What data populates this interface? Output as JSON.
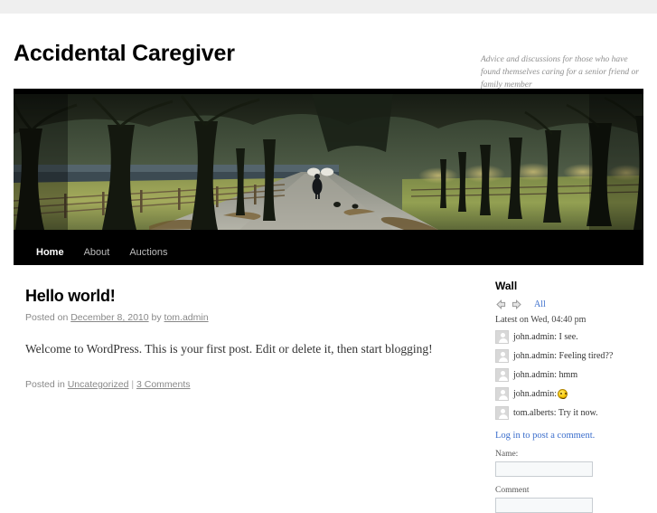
{
  "site": {
    "title": "Accidental Caregiver",
    "description": "Advice and discussions for those who have found themselves caring for a senior friend or family member"
  },
  "nav": {
    "items": [
      {
        "label": "Home",
        "current": true
      },
      {
        "label": "About",
        "current": false
      },
      {
        "label": "Auctions",
        "current": false
      }
    ]
  },
  "post": {
    "title": "Hello world!",
    "meta_prefix": "Posted on ",
    "date": "December 8, 2010",
    "meta_by": " by ",
    "author": "tom.admin",
    "content": "Welcome to WordPress. This is your first post. Edit or delete it, then start blogging!",
    "utility_prefix": "Posted in ",
    "category": "Uncategorized",
    "utility_sep": " | ",
    "comments": "3 Comments"
  },
  "sidebar": {
    "wall": {
      "title": "Wall",
      "prev_icon": "arrow-left-icon",
      "next_icon": "arrow-right-icon",
      "all_label": "All",
      "all_color": "#3b6ecc",
      "latest": "Latest on Wed, 04:40 pm",
      "messages": [
        {
          "user": "john.admin",
          "text": ": I see.",
          "emoji": false
        },
        {
          "user": "john.admin",
          "text": ": Feeling tired??",
          "emoji": false
        },
        {
          "user": "john.admin",
          "text": ": hmm",
          "emoji": false
        },
        {
          "user": "john.admin",
          "text": ": ",
          "emoji": true
        },
        {
          "user": "tom.alberts",
          "text": ": Try it now.",
          "emoji": false
        }
      ],
      "login_label": "Log in to post a comment.",
      "name_label": "Name:",
      "name_value": "",
      "comment_label": "Comment",
      "comment_value": ""
    }
  },
  "theme": {
    "nav_background": "#000000",
    "page_background": "#ffffff",
    "top_strip": "#efefef",
    "link_color": "#3b6ecc",
    "meta_color": "#888888"
  }
}
